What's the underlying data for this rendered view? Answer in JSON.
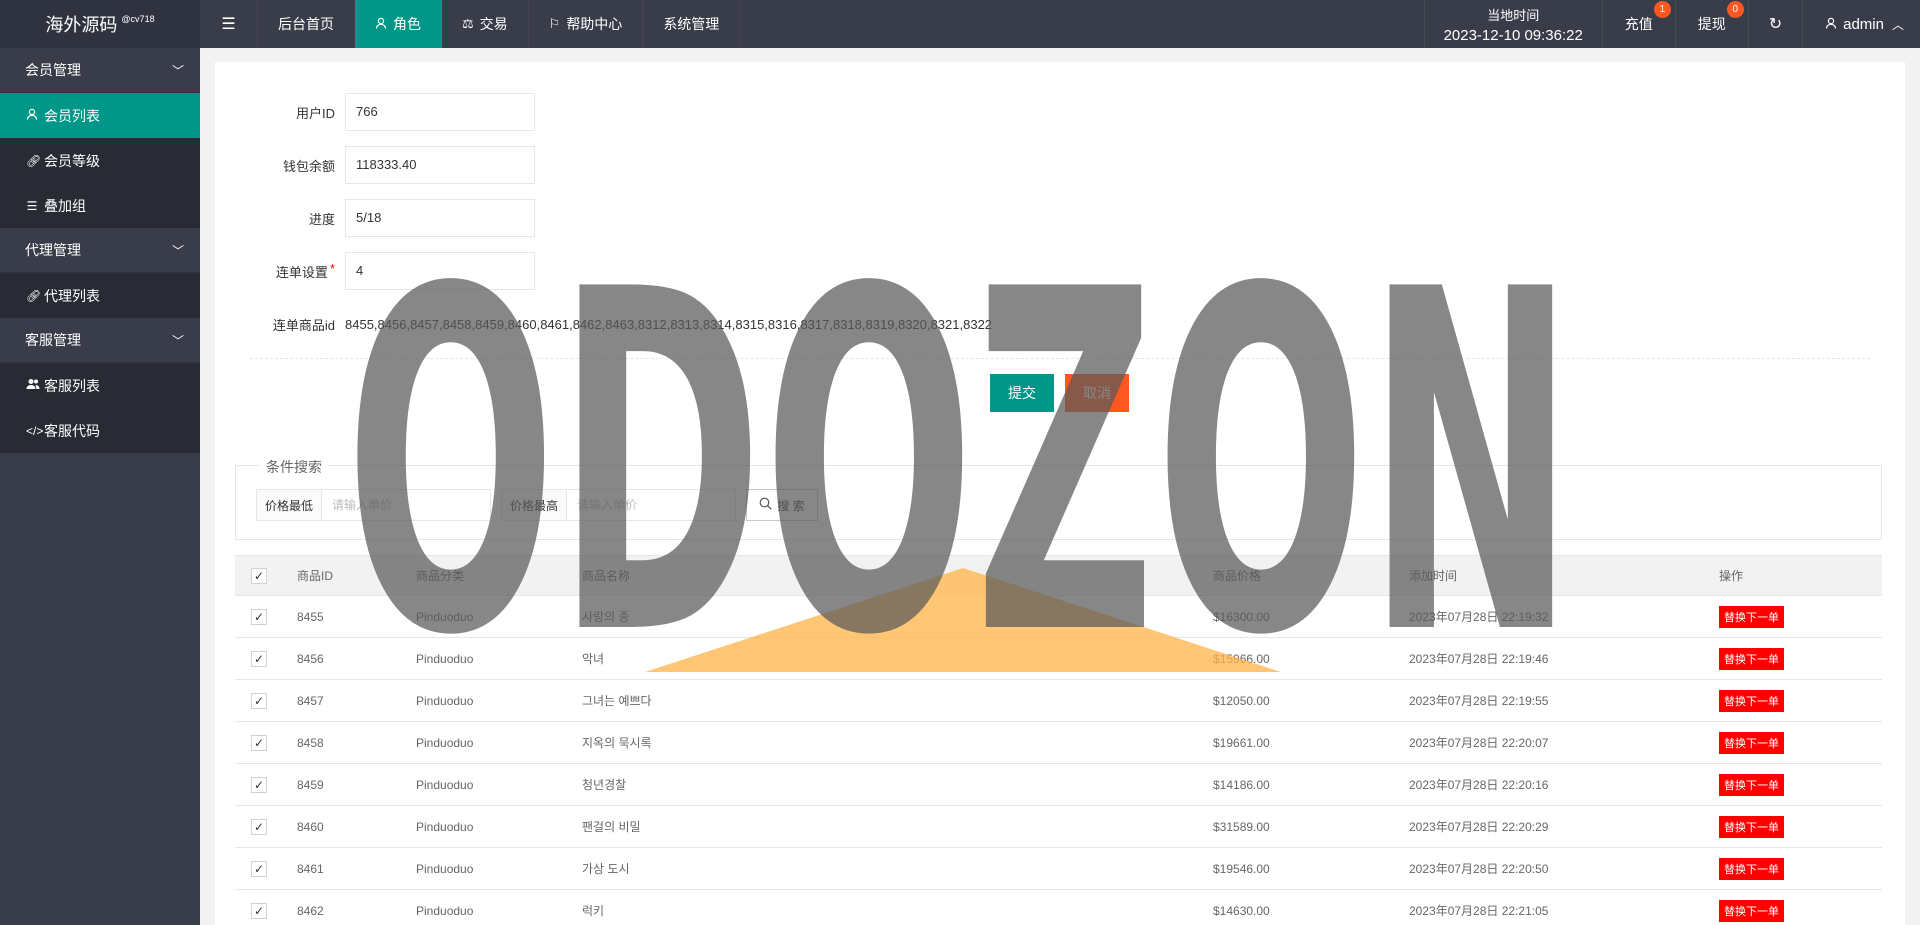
{
  "header": {
    "logo_name": "海外源码",
    "logo_tag": "@cv718",
    "toggle_icon": "menu-icon",
    "nav": [
      {
        "label": "后台首页",
        "icon": ""
      },
      {
        "label": "角色",
        "icon": "user-icon",
        "active": true
      },
      {
        "label": "交易",
        "icon": "scale-icon"
      },
      {
        "label": "帮助中心",
        "icon": "flag-icon"
      },
      {
        "label": "系统管理",
        "icon": ""
      }
    ],
    "time_label": "当地时间",
    "time_value": "2023-12-10 09:36:22",
    "recharge_label": "充值",
    "recharge_badge": "1",
    "withdraw_label": "提现",
    "withdraw_badge": "0",
    "refresh_icon": "refresh-icon",
    "admin_label": "admin"
  },
  "sidebar": {
    "groups": [
      {
        "label": "会员管理",
        "items": [
          {
            "label": "会员列表",
            "icon": "user-icon",
            "active": true
          },
          {
            "label": "会员等级",
            "icon": "link-icon"
          },
          {
            "label": "叠加组",
            "icon": "list-icon"
          }
        ]
      },
      {
        "label": "代理管理",
        "items": [
          {
            "label": "代理列表",
            "icon": "link-icon"
          }
        ]
      },
      {
        "label": "客服管理",
        "items": [
          {
            "label": "客服列表",
            "icon": "users-icon"
          },
          {
            "label": "客服代码",
            "icon": "code-icon"
          }
        ]
      }
    ]
  },
  "form": {
    "user_id_label": "用户ID",
    "user_id_value": "766",
    "balance_label": "钱包余额",
    "balance_value": "118333.40",
    "progress_label": "进度",
    "progress_value": "5/18",
    "chain_label": "连单设置",
    "chain_required_mark": "*",
    "chain_value": "4",
    "chain_ids_label": "连单商品id",
    "chain_ids_value": "8455,8456,8457,8458,8459,8460,8461,8462,8463,8312,8313,8314,8315,8316,8317,8318,8319,8320,8321,8322",
    "submit_label": "提交",
    "cancel_label": "取消"
  },
  "search": {
    "legend": "条件搜索",
    "min_label": "价格最低",
    "min_placeholder": "请输入单价",
    "max_label": "价格最高",
    "max_placeholder": "请输入单价",
    "button_label": "搜 索"
  },
  "table": {
    "headers": [
      "商品ID",
      "商品分类",
      "商品名称",
      "商品价格",
      "添加时间",
      "操作"
    ],
    "op_label": "替换下一单",
    "rows": [
      {
        "id": "8455",
        "category": "Pinduoduo",
        "name": "사랑의 종",
        "price": "$16300.00",
        "time": "2023年07月28日 22:19:32"
      },
      {
        "id": "8456",
        "category": "Pinduoduo",
        "name": "악녀",
        "price": "$15966.00",
        "time": "2023年07月28日 22:19:46"
      },
      {
        "id": "8457",
        "category": "Pinduoduo",
        "name": "그녀는 예쁘다",
        "price": "$12050.00",
        "time": "2023年07月28日 22:19:55"
      },
      {
        "id": "8458",
        "category": "Pinduoduo",
        "name": "지옥의 묵시록",
        "price": "$19661.00",
        "time": "2023年07月28日 22:20:07"
      },
      {
        "id": "8459",
        "category": "Pinduoduo",
        "name": "청년경찰",
        "price": "$14186.00",
        "time": "2023年07月28日 22:20:16"
      },
      {
        "id": "8460",
        "category": "Pinduoduo",
        "name": "팬걸의 비밀",
        "price": "$31589.00",
        "time": "2023年07月28日 22:20:29"
      },
      {
        "id": "8461",
        "category": "Pinduoduo",
        "name": "가상 도시",
        "price": "$19546.00",
        "time": "2023年07月28日 22:20:50"
      },
      {
        "id": "8462",
        "category": "Pinduoduo",
        "name": "럭키",
        "price": "$14630.00",
        "time": "2023年07月28日 22:21:05"
      }
    ]
  },
  "watermark": {
    "text": "ODOZON",
    "color": "#5a5a5a",
    "accent": "#ffb347"
  },
  "colors": {
    "primary": "#009688",
    "danger": "#ff5722",
    "red": "#ff0000",
    "dark": "#393d49"
  }
}
